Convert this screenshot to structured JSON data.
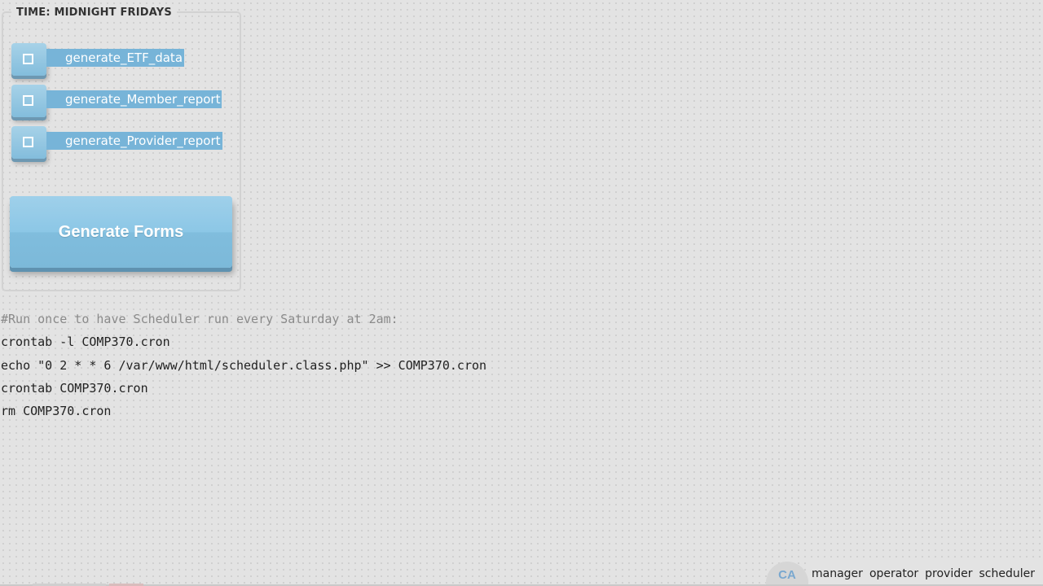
{
  "panel": {
    "title": "TIME: MIDNIGHT FRIDAYS",
    "tasks": [
      {
        "label": "generate_ETF_data"
      },
      {
        "label": "generate_Member_report"
      },
      {
        "label": "generate_Provider_report"
      }
    ],
    "generate_button": "Generate Forms"
  },
  "code": {
    "lines": [
      "#Run once to have Scheduler run every Saturday at 2am:",
      "crontab -l COMP370.cron",
      "echo \"0 2 * * 6 /var/www/html/scheduler.class.php\" >> COMP370.cron",
      "crontab COMP370.cron",
      "rm COMP370.cron"
    ]
  },
  "role_bar": {
    "badge": "CA",
    "roles": [
      "manager",
      "operator",
      "provider",
      "scheduler"
    ]
  },
  "colors": {
    "accent": "#77b4d8",
    "background": "#e3e3e3",
    "badge_text": "#7aa8cf"
  }
}
